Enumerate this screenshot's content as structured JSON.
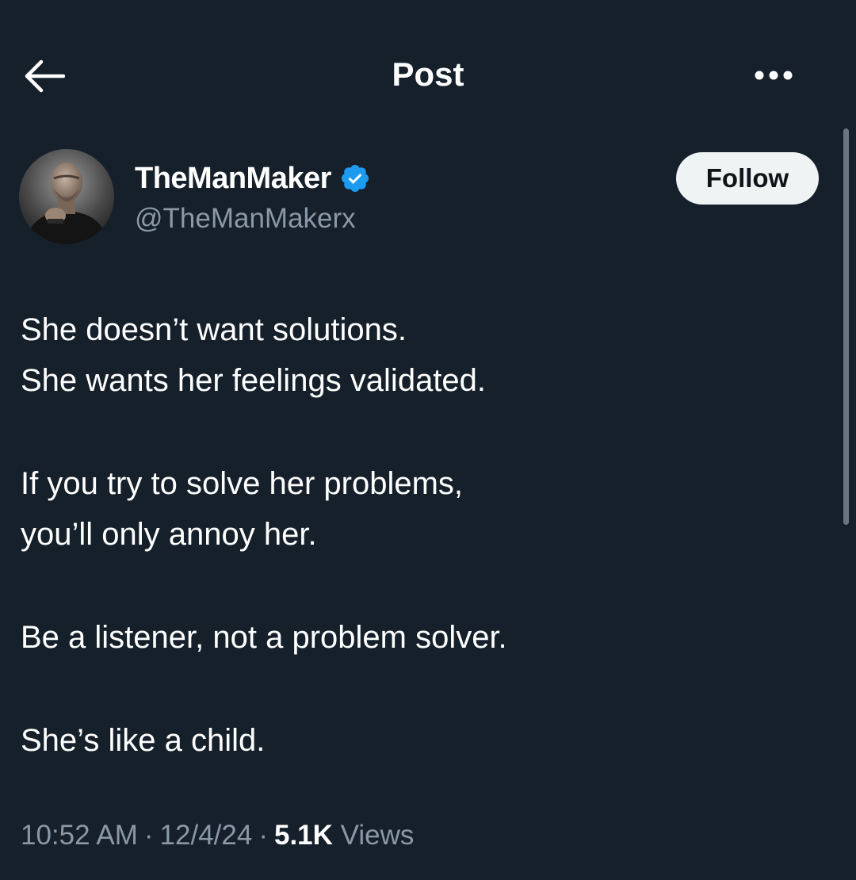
{
  "header": {
    "back_icon": "arrow-left-icon",
    "title": "Post",
    "more_icon": "more-horizontal-icon"
  },
  "author": {
    "display_name": "TheManMaker",
    "verified_icon": "verified-badge-icon",
    "handle": "@TheManMakerx",
    "follow_label": "Follow"
  },
  "post": {
    "paragraphs": [
      [
        "She doesn’t want solutions.",
        "She wants her feelings validated."
      ],
      [
        "If you try to solve her problems,",
        "you’ll only annoy her."
      ],
      [
        "Be a listener, not a problem solver."
      ],
      [
        "She’s like a child."
      ]
    ]
  },
  "meta": {
    "time": "10:52 AM",
    "separator": "·",
    "date": "12/4/24",
    "views_count": "5.1K",
    "views_label": "Views"
  },
  "colors": {
    "background": "#15202b",
    "secondary_text": "#8b98a5",
    "verified_blue": "#1d9bf0",
    "follow_bg": "#eff3f4"
  }
}
